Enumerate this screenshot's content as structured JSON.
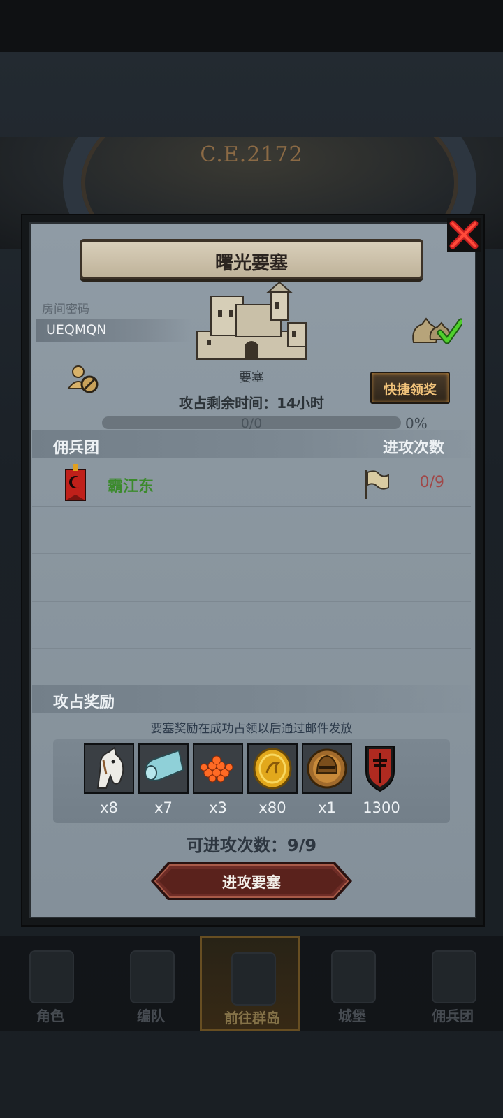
{
  "background": {
    "era_text": "C.E.2172"
  },
  "modal": {
    "title": "曙光要塞",
    "room_password_label": "房间密码",
    "room_password_value": "UEQMQN",
    "fortress_label": "要塞",
    "time_left": "攻占剩余时间：14小时",
    "quick_claim_label": "快捷领奖",
    "progress": {
      "text": "0/0",
      "percent_text": "0%",
      "fraction": 0
    },
    "mercenary_header": "佣兵团",
    "attack_times_header": "进攻次数",
    "mercenaries": [
      {
        "name": "霸江东",
        "count": "0/9"
      }
    ],
    "rewards_header": "攻占奖励",
    "rewards_note": "要塞奖励在成功占领以后通过邮件发放",
    "rewards": [
      {
        "icon": "horse-icon",
        "count": "x8"
      },
      {
        "icon": "cloth-icon",
        "count": "x7"
      },
      {
        "icon": "roe-icon",
        "count": "x3"
      },
      {
        "icon": "gold-coin-icon",
        "count": "x80"
      },
      {
        "icon": "helmet-medal-icon",
        "count": "x1"
      },
      {
        "icon": "guild-shield-icon",
        "count": "1300"
      }
    ],
    "available_attacks": "可进攻次数：9/9",
    "attack_button_label": "进攻要塞"
  },
  "bottom_nav": [
    {
      "label": "角色"
    },
    {
      "label": "编队"
    },
    {
      "label": "前往群岛",
      "active": true
    },
    {
      "label": "城堡"
    },
    {
      "label": "佣兵团"
    }
  ],
  "colors": {
    "merc_name": "#3b8a2c",
    "attack_count_red": "#a04848",
    "quick_claim_text": "#f0c27a"
  }
}
